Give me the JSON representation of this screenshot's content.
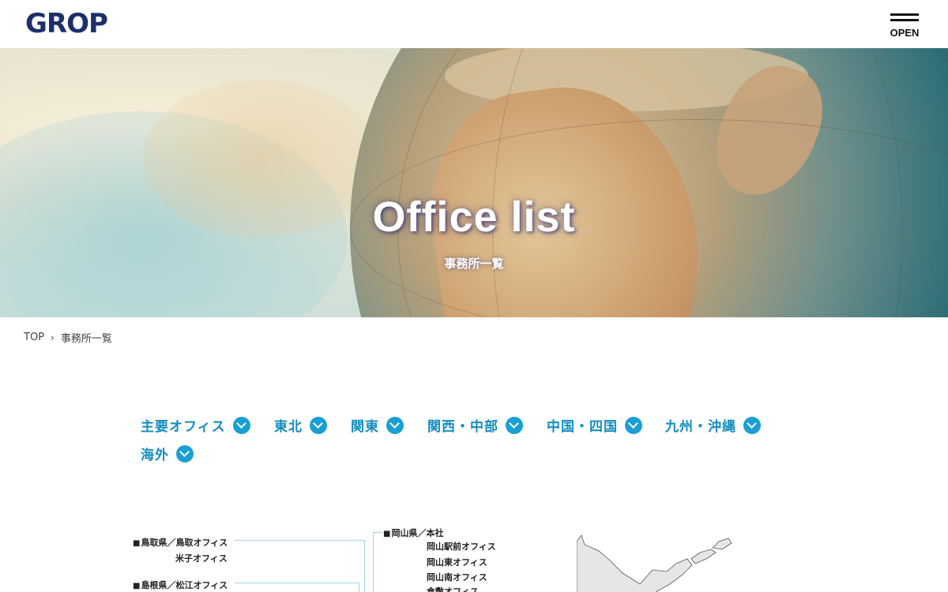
{
  "header": {
    "logo_text": "GROP",
    "menu_label": "OPEN"
  },
  "hero": {
    "title": "Office list",
    "subtitle": "事務所一覧"
  },
  "breadcrumb": {
    "home": "TOP",
    "current": "事務所一覧"
  },
  "regions": [
    {
      "label": "主要オフィス"
    },
    {
      "label": "東北"
    },
    {
      "label": "関東"
    },
    {
      "label": "関西・中部"
    },
    {
      "label": "中国・四国"
    },
    {
      "label": "九州・沖縄"
    },
    {
      "label": "海外"
    }
  ],
  "offices": {
    "tottori": "鳥取県／鳥取オフィス",
    "yonago": "米子オフィス",
    "shimane": "島根県／松江オフィス",
    "okayama_hq": "岡山県／本社",
    "okayama_station": "岡山駅前オフィス",
    "okayama_east": "岡山東オフィス",
    "okayama_south": "岡山南オフィス",
    "kurashiki": "倉敷オフィス"
  },
  "colors": {
    "accent": "#1a9fd4",
    "region_text": "#138dbf",
    "brand_navy": "#1c2f6b",
    "brand_green": "#3aa35a",
    "map_line": "#9fd6e4"
  }
}
